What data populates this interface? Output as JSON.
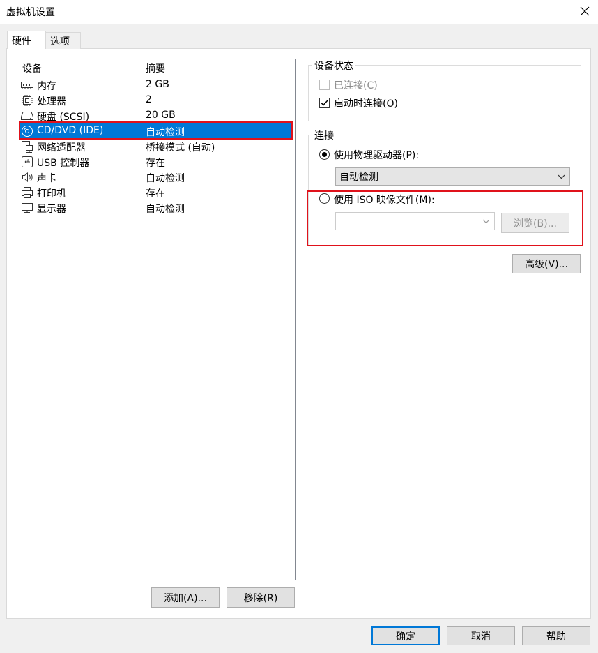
{
  "window": {
    "title": "虚拟机设置"
  },
  "tabs": [
    {
      "label": "硬件",
      "active": true
    },
    {
      "label": "选项",
      "active": false
    }
  ],
  "device_list": {
    "columns": [
      "设备",
      "摘要"
    ],
    "rows": [
      {
        "device": "内存",
        "summary": "2 GB",
        "icon": "memory-icon",
        "selected": false
      },
      {
        "device": "处理器",
        "summary": "2",
        "icon": "processor-icon",
        "selected": false
      },
      {
        "device": "硬盘 (SCSI)",
        "summary": "20 GB",
        "icon": "hard-disk-icon",
        "selected": false
      },
      {
        "device": "CD/DVD (IDE)",
        "summary": "自动检测",
        "icon": "cd-dvd-icon",
        "selected": true
      },
      {
        "device": "网络适配器",
        "summary": "桥接模式 (自动)",
        "icon": "network-adapter-icon",
        "selected": false
      },
      {
        "device": "USB 控制器",
        "summary": "存在",
        "icon": "usb-icon",
        "selected": false
      },
      {
        "device": "声卡",
        "summary": "自动检测",
        "icon": "sound-icon",
        "selected": false
      },
      {
        "device": "打印机",
        "summary": "存在",
        "icon": "printer-icon",
        "selected": false
      },
      {
        "device": "显示器",
        "summary": "自动检测",
        "icon": "display-icon",
        "selected": false
      }
    ],
    "add_button": "添加(A)...",
    "remove_button": "移除(R)"
  },
  "device_status": {
    "group_label": "设备状态",
    "connected_label": "已连接(C)",
    "connected_checked": false,
    "connected_enabled": false,
    "connect_at_power_on_label": "启动时连接(O)",
    "connect_at_power_on_checked": true
  },
  "connection": {
    "group_label": "连接",
    "physical_drive_label": "使用物理驱动器(P):",
    "physical_drive_selected": true,
    "physical_drive_value": "自动检测",
    "iso_label": "使用 ISO 映像文件(M):",
    "iso_selected": false,
    "iso_value": "",
    "browse_button": "浏览(B)..."
  },
  "advanced_button": "高级(V)...",
  "footer": {
    "ok": "确定",
    "cancel": "取消",
    "help": "帮助"
  },
  "colors": {
    "selection": "#0078d7",
    "highlight_outline": "#e0121b",
    "dialog_background": "#f0f0f0"
  }
}
